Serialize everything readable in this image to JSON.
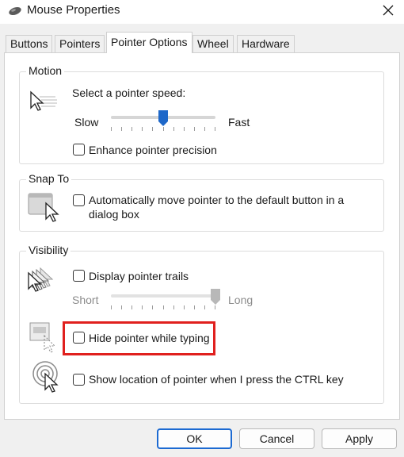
{
  "window": {
    "title": "Mouse Properties"
  },
  "tabs": [
    {
      "label": "Buttons"
    },
    {
      "label": "Pointers"
    },
    {
      "label": "Pointer Options"
    },
    {
      "label": "Wheel"
    },
    {
      "label": "Hardware"
    }
  ],
  "active_tab": "Pointer Options",
  "motion": {
    "title": "Motion",
    "speed_label": "Select a pointer speed:",
    "slow_label": "Slow",
    "fast_label": "Fast",
    "speed_fraction": 0.5,
    "enhance_label": "Enhance pointer precision",
    "enhance_checked": false
  },
  "snap": {
    "title": "Snap To",
    "auto_move_line1": "Automatically move pointer to the default button in a",
    "auto_move_line2": "dialog box",
    "auto_move_checked": false
  },
  "visibility": {
    "title": "Visibility",
    "trails_label": "Display pointer trails",
    "trails_checked": false,
    "short_label": "Short",
    "long_label": "Long",
    "trail_length_fraction": 1.0,
    "hide_label": "Hide pointer while typing",
    "hide_checked": false,
    "show_location_label": "Show location of pointer when I press the CTRL key",
    "show_location_checked": false
  },
  "buttons": {
    "ok": "OK",
    "cancel": "Cancel",
    "apply": "Apply"
  },
  "colors": {
    "accent": "#1c6ad2",
    "highlight": "#e0201e",
    "thumb": "#1e68c9"
  },
  "icons": [
    "mouse-icon",
    "close-icon",
    "pointer-speed-icon",
    "snap-to-icon",
    "pointer-trails-icon",
    "hide-pointer-icon",
    "show-location-icon"
  ]
}
